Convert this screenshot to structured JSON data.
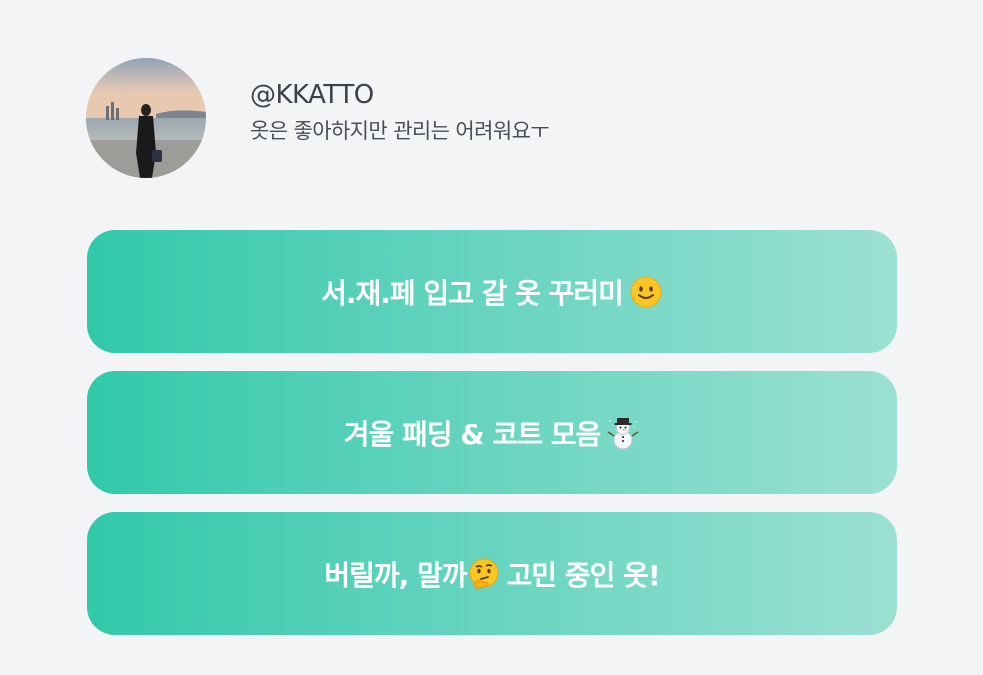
{
  "profile": {
    "username": "@KKATTO",
    "bio": "옷은 좋아하지만 관리는 어려워요ㅜ"
  },
  "links": [
    {
      "label": "서.재.페 입고 갈 옷 꾸러미",
      "emoji": "smiling-face-icon"
    },
    {
      "label": "겨울 패딩 & 코트 모음",
      "emoji": "snowman-icon"
    },
    {
      "label_before": "버릴까, 말까",
      "label_after": "고민 중인 옷!",
      "emoji": "thinking-face-icon"
    }
  ],
  "colors": {
    "background": "#f2f4f6",
    "button_gradient_start": "#31c9a9",
    "button_gradient_end": "#9be0d3",
    "button_text": "#ffffff"
  }
}
